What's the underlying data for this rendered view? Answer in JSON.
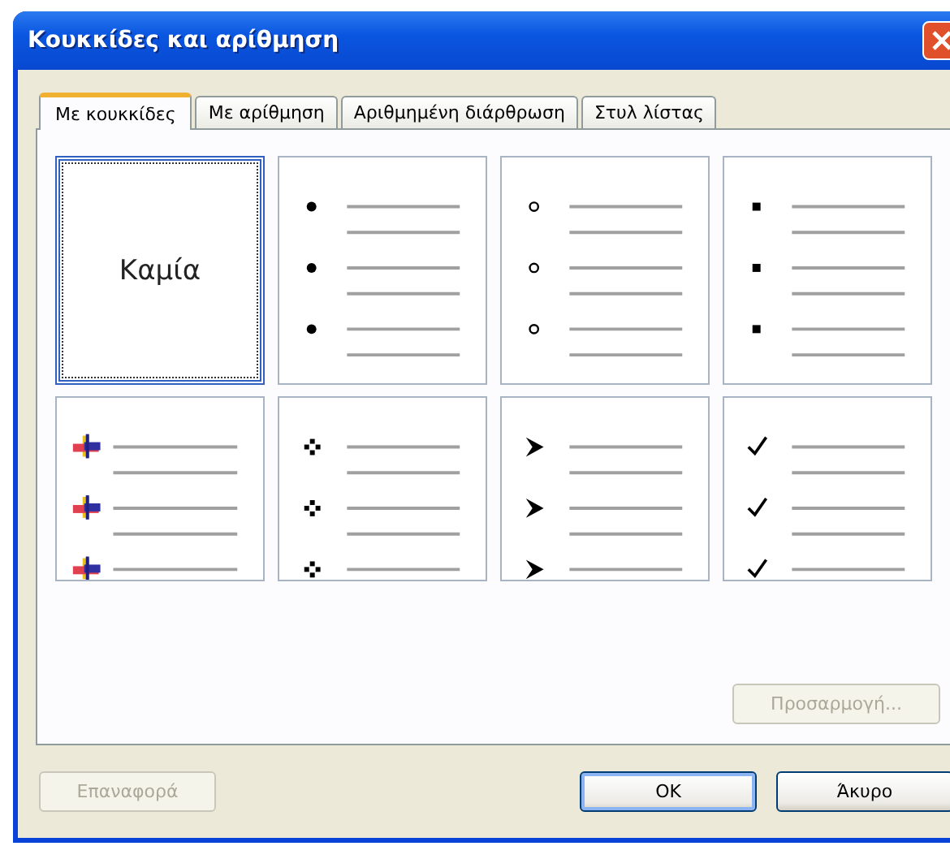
{
  "window": {
    "title": "Κουκκίδες και αρίθμηση"
  },
  "tabs": [
    {
      "label": "Με κουκκίδες",
      "selected": true
    },
    {
      "label": "Με αρίθμηση",
      "selected": false
    },
    {
      "label": "Αριθμημένη διάρθρωση",
      "selected": false
    },
    {
      "label": "Στυλ λίστας",
      "selected": false
    }
  ],
  "cells": [
    {
      "kind": "none",
      "label": "Καμία",
      "selected": true
    },
    {
      "kind": "disc",
      "selected": false
    },
    {
      "kind": "circle",
      "selected": false
    },
    {
      "kind": "square",
      "selected": false
    },
    {
      "kind": "picture",
      "selected": false
    },
    {
      "kind": "diamonds",
      "selected": false
    },
    {
      "kind": "arrowhead",
      "selected": false
    },
    {
      "kind": "check",
      "selected": false
    }
  ],
  "customize_button": {
    "label": "Προσαρμογή...",
    "disabled": true
  },
  "reset_button": {
    "label": "Επαναφορά",
    "disabled": true
  },
  "ok_button": {
    "label": "OK"
  },
  "cancel_button": {
    "label": "Άκυρο"
  }
}
